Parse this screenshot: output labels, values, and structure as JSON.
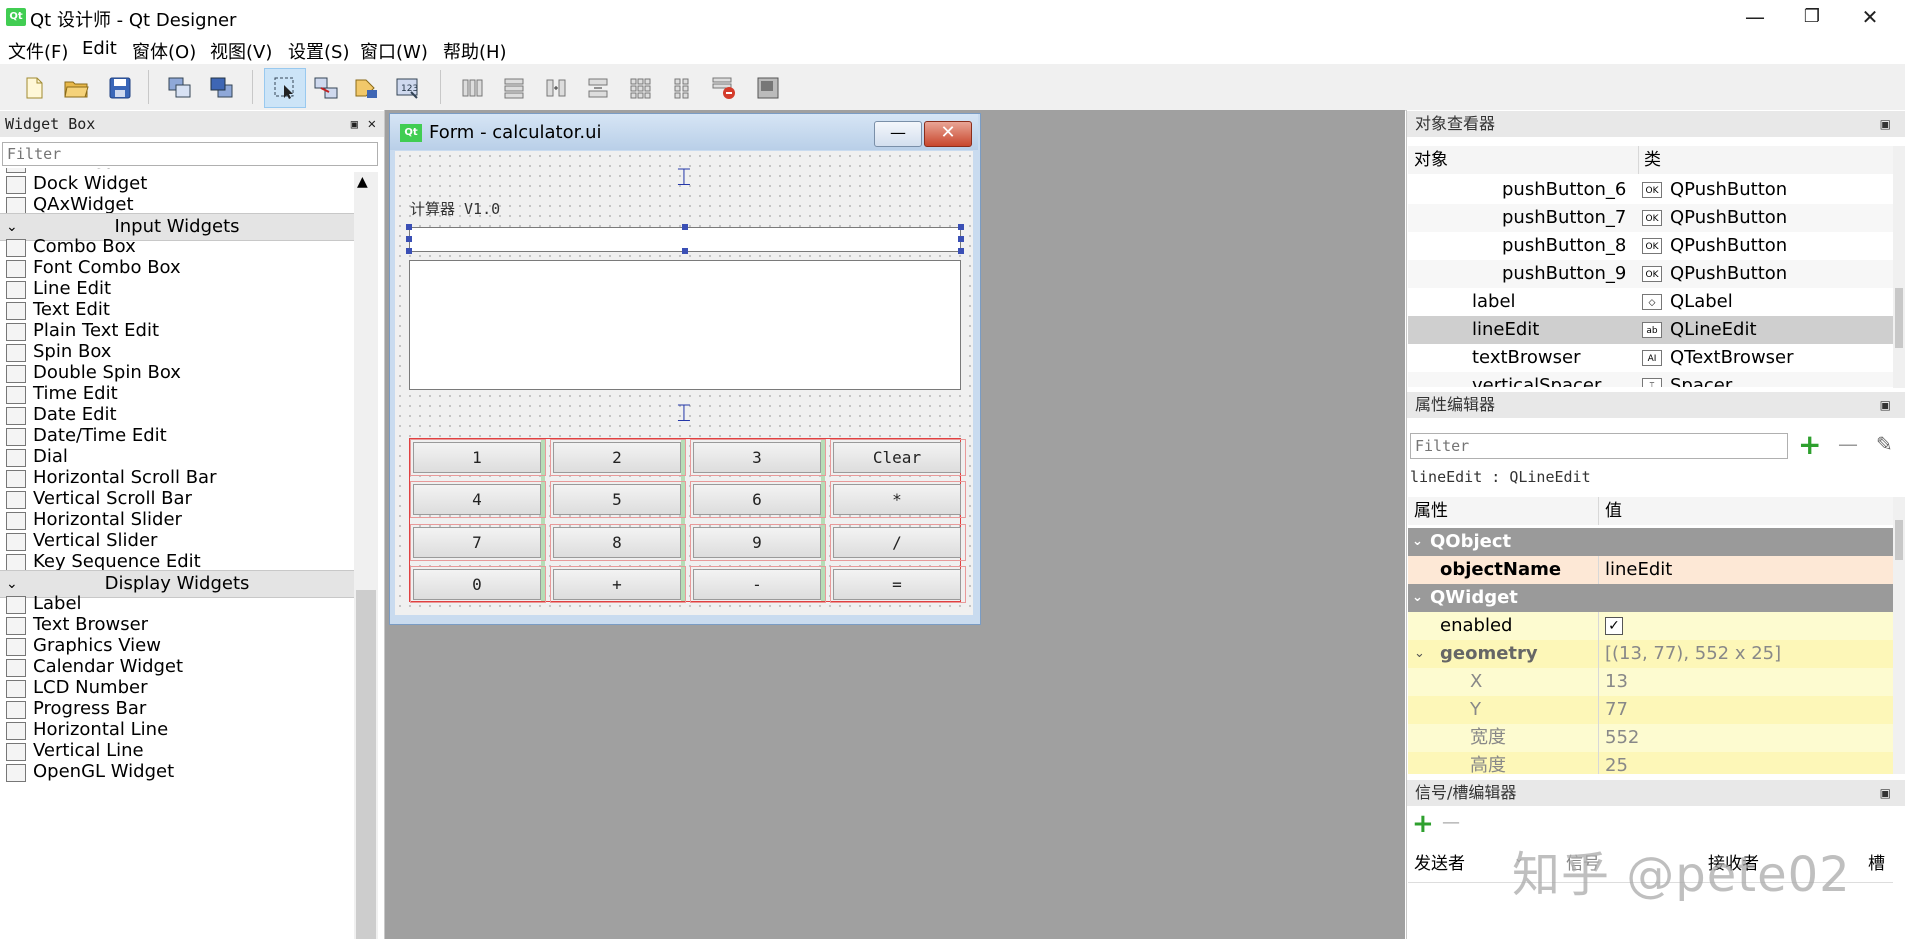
{
  "window": {
    "app_icon": "Qt",
    "title": "Qt 设计师 - Qt Designer",
    "minimize": "—",
    "restore": "❐",
    "close": "✕"
  },
  "menubar": [
    "文件(F)",
    "Edit",
    "窗体(O)",
    "视图(V)",
    "设置(S)",
    "窗口(W)",
    "帮助(H)"
  ],
  "toolbar": {
    "icons": [
      "new-file-icon",
      "open-folder-icon",
      "save-icon",
      "send-to-back-icon",
      "bring-to-front-icon",
      "edit-widgets-icon",
      "edit-signals-slots-icon",
      "edit-buddies-icon",
      "edit-tab-order-icon",
      "layout-horizontal-icon",
      "layout-vertical-icon",
      "layout-splitter-horizontal-icon",
      "layout-splitter-vertical-icon",
      "layout-grid-icon",
      "layout-form-icon",
      "break-layout-icon",
      "adjust-size-icon"
    ]
  },
  "widget_box": {
    "title": "Widget Box",
    "filter_placeholder": "Filter",
    "items_top": [
      {
        "label": "MDI Area",
        "icon": "mdi-area-icon"
      },
      {
        "label": "Dock Widget",
        "icon": "dock-widget-icon"
      },
      {
        "label": "QAxWidget",
        "icon": "qaxwidget-icon"
      }
    ],
    "category_input": "Input Widgets",
    "input_items": [
      {
        "label": "Combo Box",
        "icon": "combo-box-icon"
      },
      {
        "label": "Font Combo Box",
        "icon": "font-combo-box-icon"
      },
      {
        "label": "Line Edit",
        "icon": "line-edit-icon"
      },
      {
        "label": "Text Edit",
        "icon": "text-edit-icon"
      },
      {
        "label": "Plain Text Edit",
        "icon": "plain-text-edit-icon"
      },
      {
        "label": "Spin Box",
        "icon": "spin-box-icon"
      },
      {
        "label": "Double Spin Box",
        "icon": "double-spin-box-icon"
      },
      {
        "label": "Time Edit",
        "icon": "time-edit-icon"
      },
      {
        "label": "Date Edit",
        "icon": "date-edit-icon"
      },
      {
        "label": "Date/Time Edit",
        "icon": "datetime-edit-icon"
      },
      {
        "label": "Dial",
        "icon": "dial-icon"
      },
      {
        "label": "Horizontal Scroll Bar",
        "icon": "hscrollbar-icon"
      },
      {
        "label": "Vertical Scroll Bar",
        "icon": "vscrollbar-icon"
      },
      {
        "label": "Horizontal Slider",
        "icon": "hslider-icon"
      },
      {
        "label": "Vertical Slider",
        "icon": "vslider-icon"
      },
      {
        "label": "Key Sequence Edit",
        "icon": "key-sequence-edit-icon"
      }
    ],
    "category_display": "Display Widgets",
    "display_items": [
      {
        "label": "Label",
        "icon": "label-icon"
      },
      {
        "label": "Text Browser",
        "icon": "text-browser-icon"
      },
      {
        "label": "Graphics View",
        "icon": "graphics-view-icon"
      },
      {
        "label": "Calendar Widget",
        "icon": "calendar-widget-icon"
      },
      {
        "label": "LCD Number",
        "icon": "lcd-number-icon"
      },
      {
        "label": "Progress Bar",
        "icon": "progress-bar-icon"
      },
      {
        "label": "Horizontal Line",
        "icon": "horizontal-line-icon"
      },
      {
        "label": "Vertical Line",
        "icon": "vertical-line-icon"
      },
      {
        "label": "OpenGL Widget",
        "icon": "opengl-widget-icon"
      }
    ]
  },
  "form": {
    "icon": "Qt",
    "title": "Form - calculator.ui",
    "minimize": "—",
    "close": "✕",
    "label": "计算器 V1.0",
    "buttons": [
      [
        "1",
        "2",
        "3",
        "Clear"
      ],
      [
        "4",
        "5",
        "6",
        "*"
      ],
      [
        "7",
        "8",
        "9",
        "/"
      ],
      [
        "0",
        "+",
        "-",
        "="
      ]
    ]
  },
  "object_inspector": {
    "title": "对象查看器",
    "col_object": "对象",
    "col_class": "类",
    "rows": [
      {
        "name": "pushButton_6",
        "class": "QPushButton",
        "icon": "OK",
        "indent": 2
      },
      {
        "name": "pushButton_7",
        "class": "QPushButton",
        "icon": "OK",
        "indent": 2
      },
      {
        "name": "pushButton_8",
        "class": "QPushButton",
        "icon": "OK",
        "indent": 2
      },
      {
        "name": "pushButton_9",
        "class": "QPushButton",
        "icon": "OK",
        "indent": 2
      },
      {
        "name": "label",
        "class": "QLabel",
        "icon": "◇",
        "indent": 1
      },
      {
        "name": "lineEdit",
        "class": "QLineEdit",
        "icon": "ab",
        "indent": 1
      },
      {
        "name": "textBrowser",
        "class": "QTextBrowser",
        "icon": "AI",
        "indent": 1
      },
      {
        "name": "verticalSpacer",
        "class": "Spacer",
        "icon": "⌶",
        "indent": 1
      }
    ]
  },
  "property_editor": {
    "title": "属性编辑器",
    "filter_placeholder": "Filter",
    "add": "+",
    "remove": "—",
    "configure": "✎",
    "context": "lineEdit : QLineEdit",
    "col_property": "属性",
    "col_value": "值",
    "group_qobject": "QObject",
    "group_qwidget": "QWidget",
    "rows": [
      {
        "key": "objectName",
        "value": "lineEdit"
      },
      {
        "key": "enabled",
        "value": "✓"
      },
      {
        "key": "geometry",
        "value": "[(13, 77), 552 x 25]"
      },
      {
        "key": "X",
        "value": "13"
      },
      {
        "key": "Y",
        "value": "77"
      },
      {
        "key": "宽度",
        "value": "552"
      },
      {
        "key": "高度",
        "value": "25"
      }
    ]
  },
  "signal_slot_editor": {
    "title": "信号/槽编辑器",
    "add": "+",
    "remove": "—",
    "columns": [
      "发送者",
      "信号",
      "接收者",
      "槽"
    ]
  },
  "watermark": "知乎 @pete02"
}
